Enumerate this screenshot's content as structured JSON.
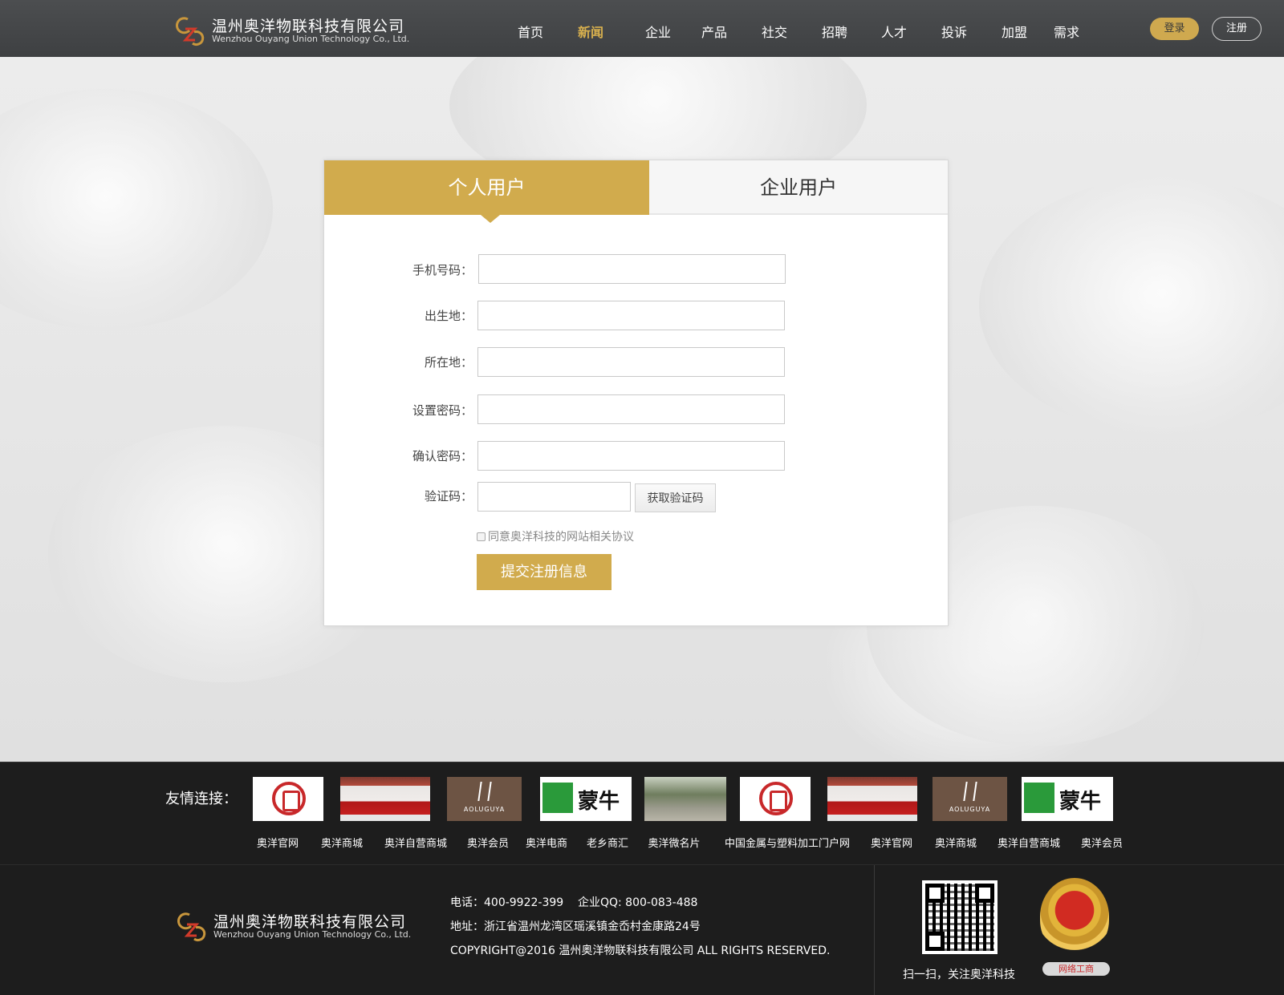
{
  "header": {
    "company_cn": "温州奥洋物联科技有限公司",
    "company_en": "Wenzhou Ouyang Union Technology Co., Ltd.",
    "nav": [
      "首页",
      "新闻",
      "企业",
      "产品",
      "社交",
      "招聘",
      "人才",
      "投诉",
      "加盟",
      "需求"
    ],
    "active_nav": "新闻",
    "login_label": "登录",
    "register_label": "注册"
  },
  "form": {
    "tab_personal": "个人用户",
    "tab_company": "企业用户",
    "fields": [
      {
        "label": "手机号码：",
        "value": ""
      },
      {
        "label": "出生地：",
        "value": ""
      },
      {
        "label": "所在地：",
        "value": ""
      },
      {
        "label": "设置密码：",
        "value": ""
      },
      {
        "label": "确认密码：",
        "value": ""
      },
      {
        "label": "验证码：",
        "value": ""
      }
    ],
    "get_code_label": "获取验证码",
    "agree_text": "同意奥洋科技的网站相关协议",
    "submit_label": "提交注册信息"
  },
  "links": {
    "title": "友情连接：",
    "logos": [
      {
        "name": "hongri-logo"
      },
      {
        "name": "banner-photo"
      },
      {
        "name": "aoluguya-logo",
        "text": "AOLUGUYA"
      },
      {
        "name": "mengniu-logo",
        "text": "蒙牛"
      },
      {
        "name": "gate-photo"
      },
      {
        "name": "hongri-logo"
      },
      {
        "name": "banner-photo"
      },
      {
        "name": "aoluguya-logo",
        "text": "AOLUGUYA"
      },
      {
        "name": "mengniu-logo",
        "text": "蒙牛"
      }
    ],
    "labels": [
      "奥洋官网",
      "奥洋商城",
      "奥洋自营商城",
      "奥洋会员",
      "奥洋电商",
      "老乡商汇",
      "奥洋微名片",
      "中国金属与塑料加工门户网",
      "奥洋官网",
      "奥洋商城",
      "奥洋自营商城",
      "奥洋会员"
    ]
  },
  "footer": {
    "company_cn": "温州奥洋物联科技有限公司",
    "company_en": "Wenzhou Ouyang Union Technology Co., Ltd.",
    "phone_line": "电话：400-9922-399    企业QQ: 800-083-488",
    "address_line": "地址：浙江省温州龙湾区瑶溪镇金岙村金康路24号",
    "copyright_line": "COPYRIGHT@2016 温州奥洋物联科技有限公司 ALL RIGHTS RESERVED.",
    "qr_caption": "扫一扫，关注奥洋科技",
    "badge_label": "网络工商"
  },
  "colors": {
    "accent_gold": "#d1ab4d",
    "header_bg": "#444648",
    "footer_bg": "#1d1d1d"
  }
}
